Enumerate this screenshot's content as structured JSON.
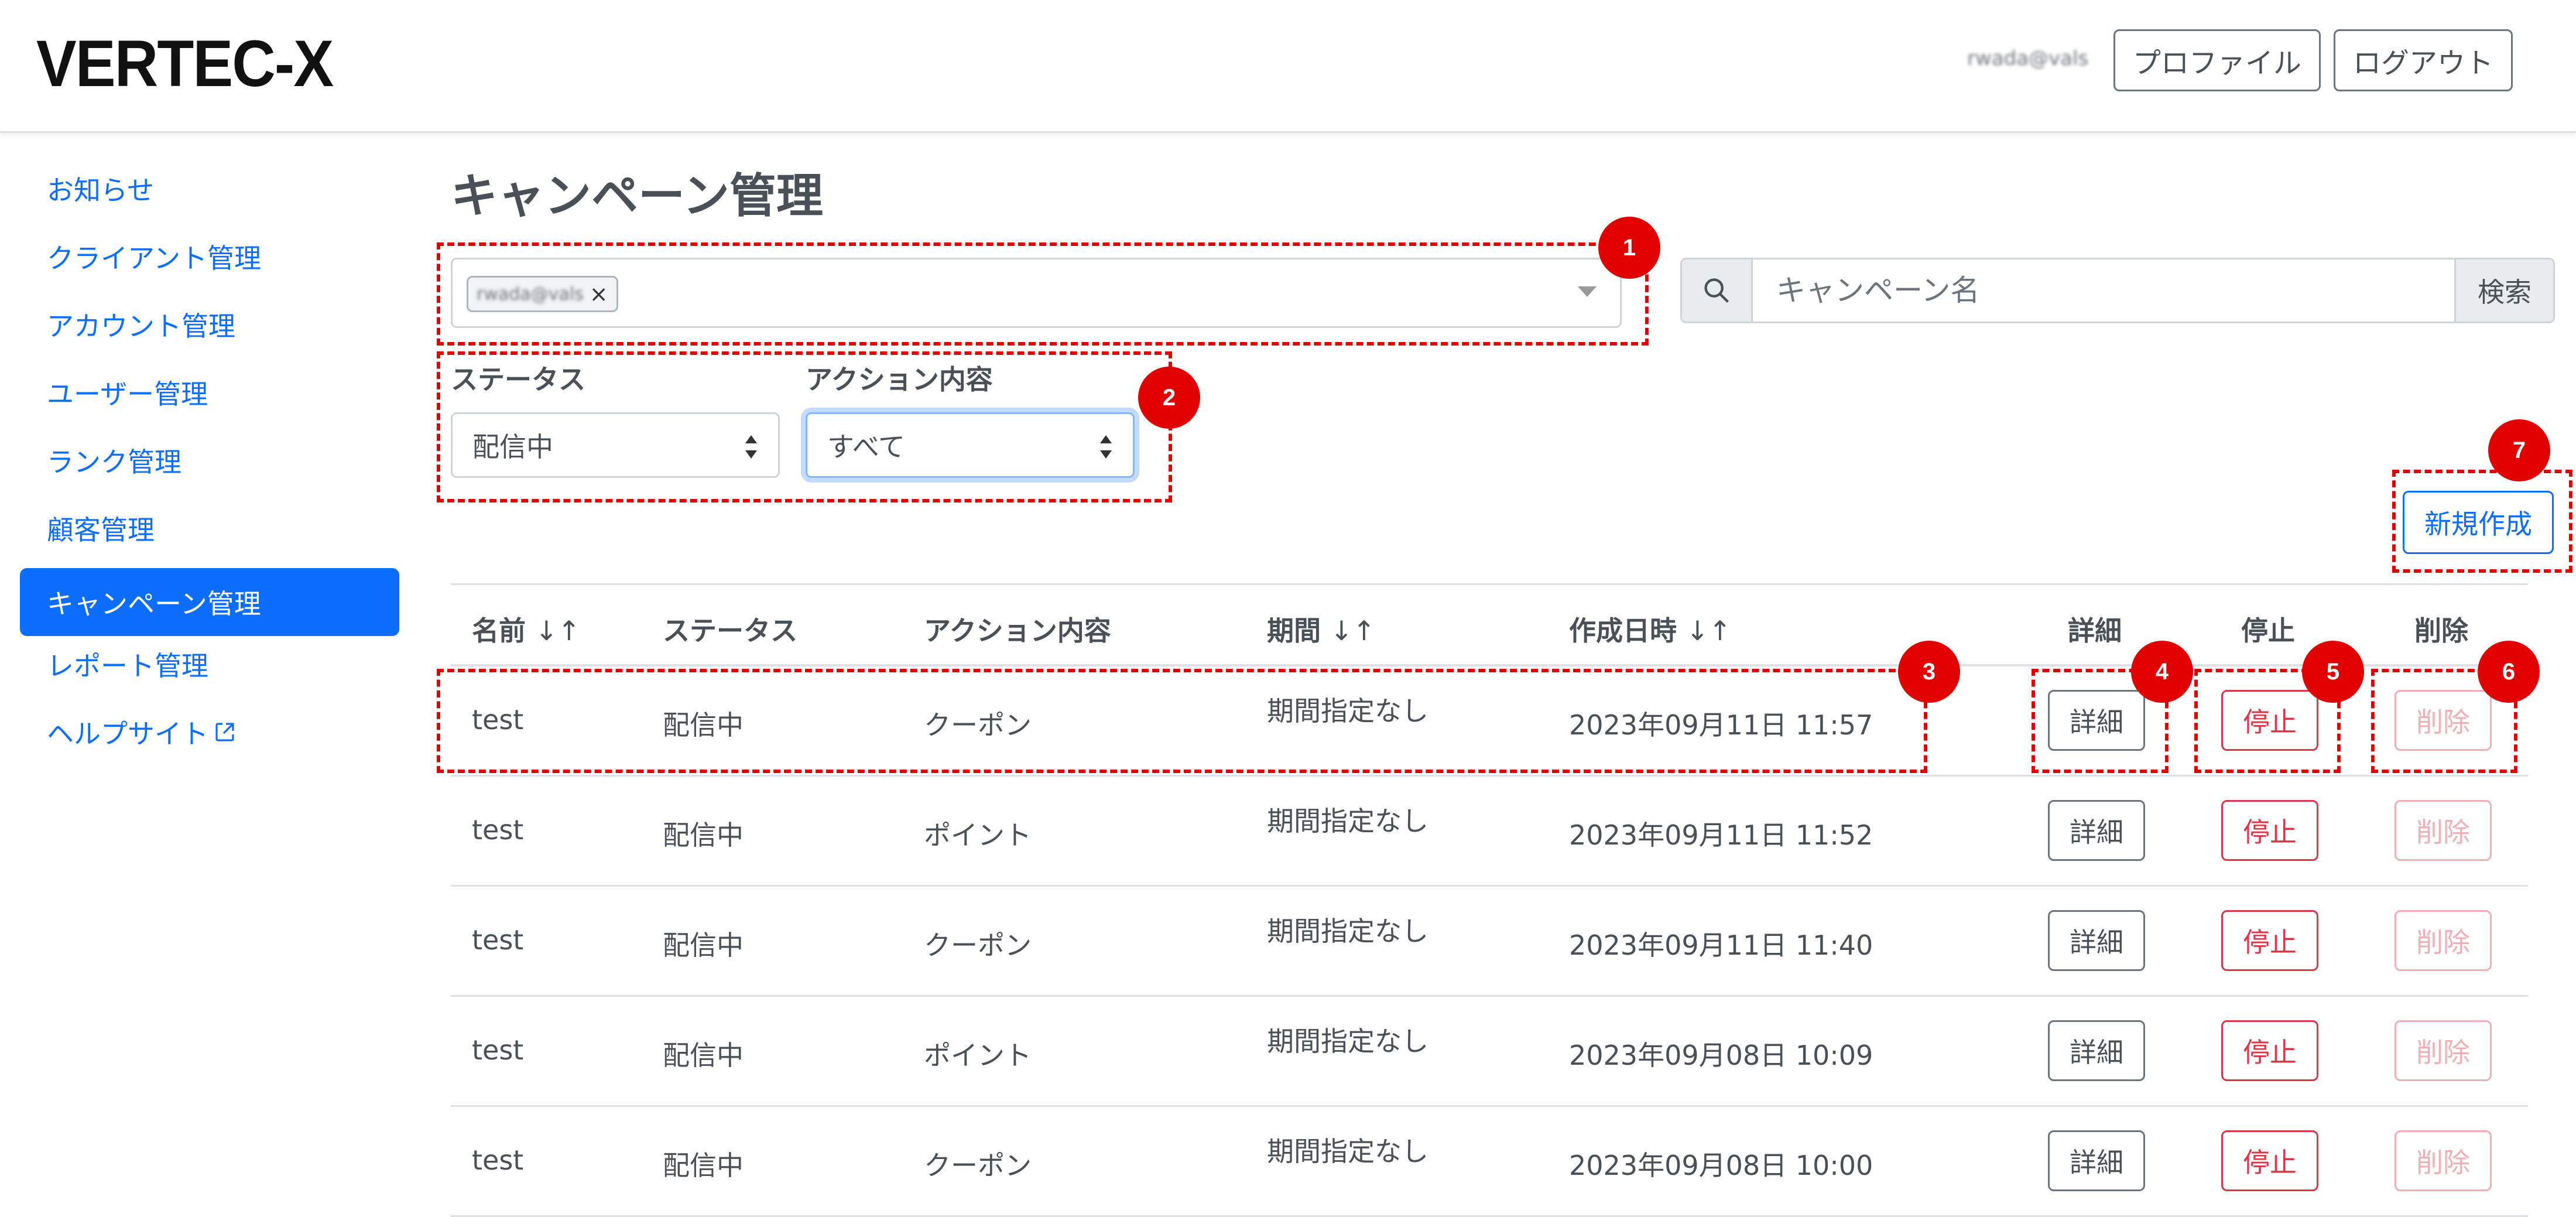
{
  "header": {
    "logo": "VERTEC-X",
    "user_email": "rwada@vals",
    "profile_label": "プロファイル",
    "logout_label": "ログアウト"
  },
  "sidebar": {
    "items": [
      {
        "label": "お知らせ",
        "active": false
      },
      {
        "label": "クライアント管理",
        "active": false
      },
      {
        "label": "アカウント管理",
        "active": false
      },
      {
        "label": "ユーザー管理",
        "active": false
      },
      {
        "label": "ランク管理",
        "active": false
      },
      {
        "label": "顧客管理",
        "active": false
      },
      {
        "label": "キャンペーン管理",
        "active": true
      },
      {
        "label": "レポート管理",
        "active": false
      },
      {
        "label": "ヘルプサイト",
        "active": false,
        "external_icon": "external-link-icon"
      }
    ]
  },
  "main": {
    "title": "キャンペーン管理",
    "account_select": {
      "chip": "rwada@vals"
    },
    "search": {
      "placeholder": "キャンペーン名",
      "button": "検索",
      "icon": "search-icon"
    },
    "filters": {
      "status": {
        "label": "ステータス",
        "value": "配信中"
      },
      "action": {
        "label": "アクション内容",
        "value": "すべて"
      }
    },
    "new_button": "新規作成",
    "table": {
      "headers": {
        "name": "名前",
        "status": "ステータス",
        "action": "アクション内容",
        "period": "期間",
        "created": "作成日時",
        "detail": "詳細",
        "stop": "停止",
        "delete": "削除"
      },
      "rows": [
        {
          "name": "test",
          "status": "配信中",
          "action": "クーポン",
          "period": "期間指定なし",
          "created": "2023年09月11日 11:57",
          "detail": "詳細",
          "stop": "停止",
          "delete": "削除"
        },
        {
          "name": "test",
          "status": "配信中",
          "action": "ポイント",
          "period": "期間指定なし",
          "created": "2023年09月11日 11:52",
          "detail": "詳細",
          "stop": "停止",
          "delete": "削除"
        },
        {
          "name": "test",
          "status": "配信中",
          "action": "クーポン",
          "period": "期間指定なし",
          "created": "2023年09月11日 11:40",
          "detail": "詳細",
          "stop": "停止",
          "delete": "削除"
        },
        {
          "name": "test",
          "status": "配信中",
          "action": "ポイント",
          "period": "期間指定なし",
          "created": "2023年09月08日 10:09",
          "detail": "詳細",
          "stop": "停止",
          "delete": "削除"
        },
        {
          "name": "test",
          "status": "配信中",
          "action": "クーポン",
          "period": "期間指定なし",
          "created": "2023年09月08日 10:00",
          "detail": "詳細",
          "stop": "停止",
          "delete": "削除"
        }
      ]
    }
  },
  "annotations": {
    "markers": [
      "1",
      "2",
      "3",
      "4",
      "5",
      "6",
      "7"
    ],
    "color": "#e00000"
  },
  "colors": {
    "primary": "#0d6efd",
    "danger": "#dc3545",
    "danger_disabled": "#f1aeb5",
    "secondary": "#6c757d"
  }
}
